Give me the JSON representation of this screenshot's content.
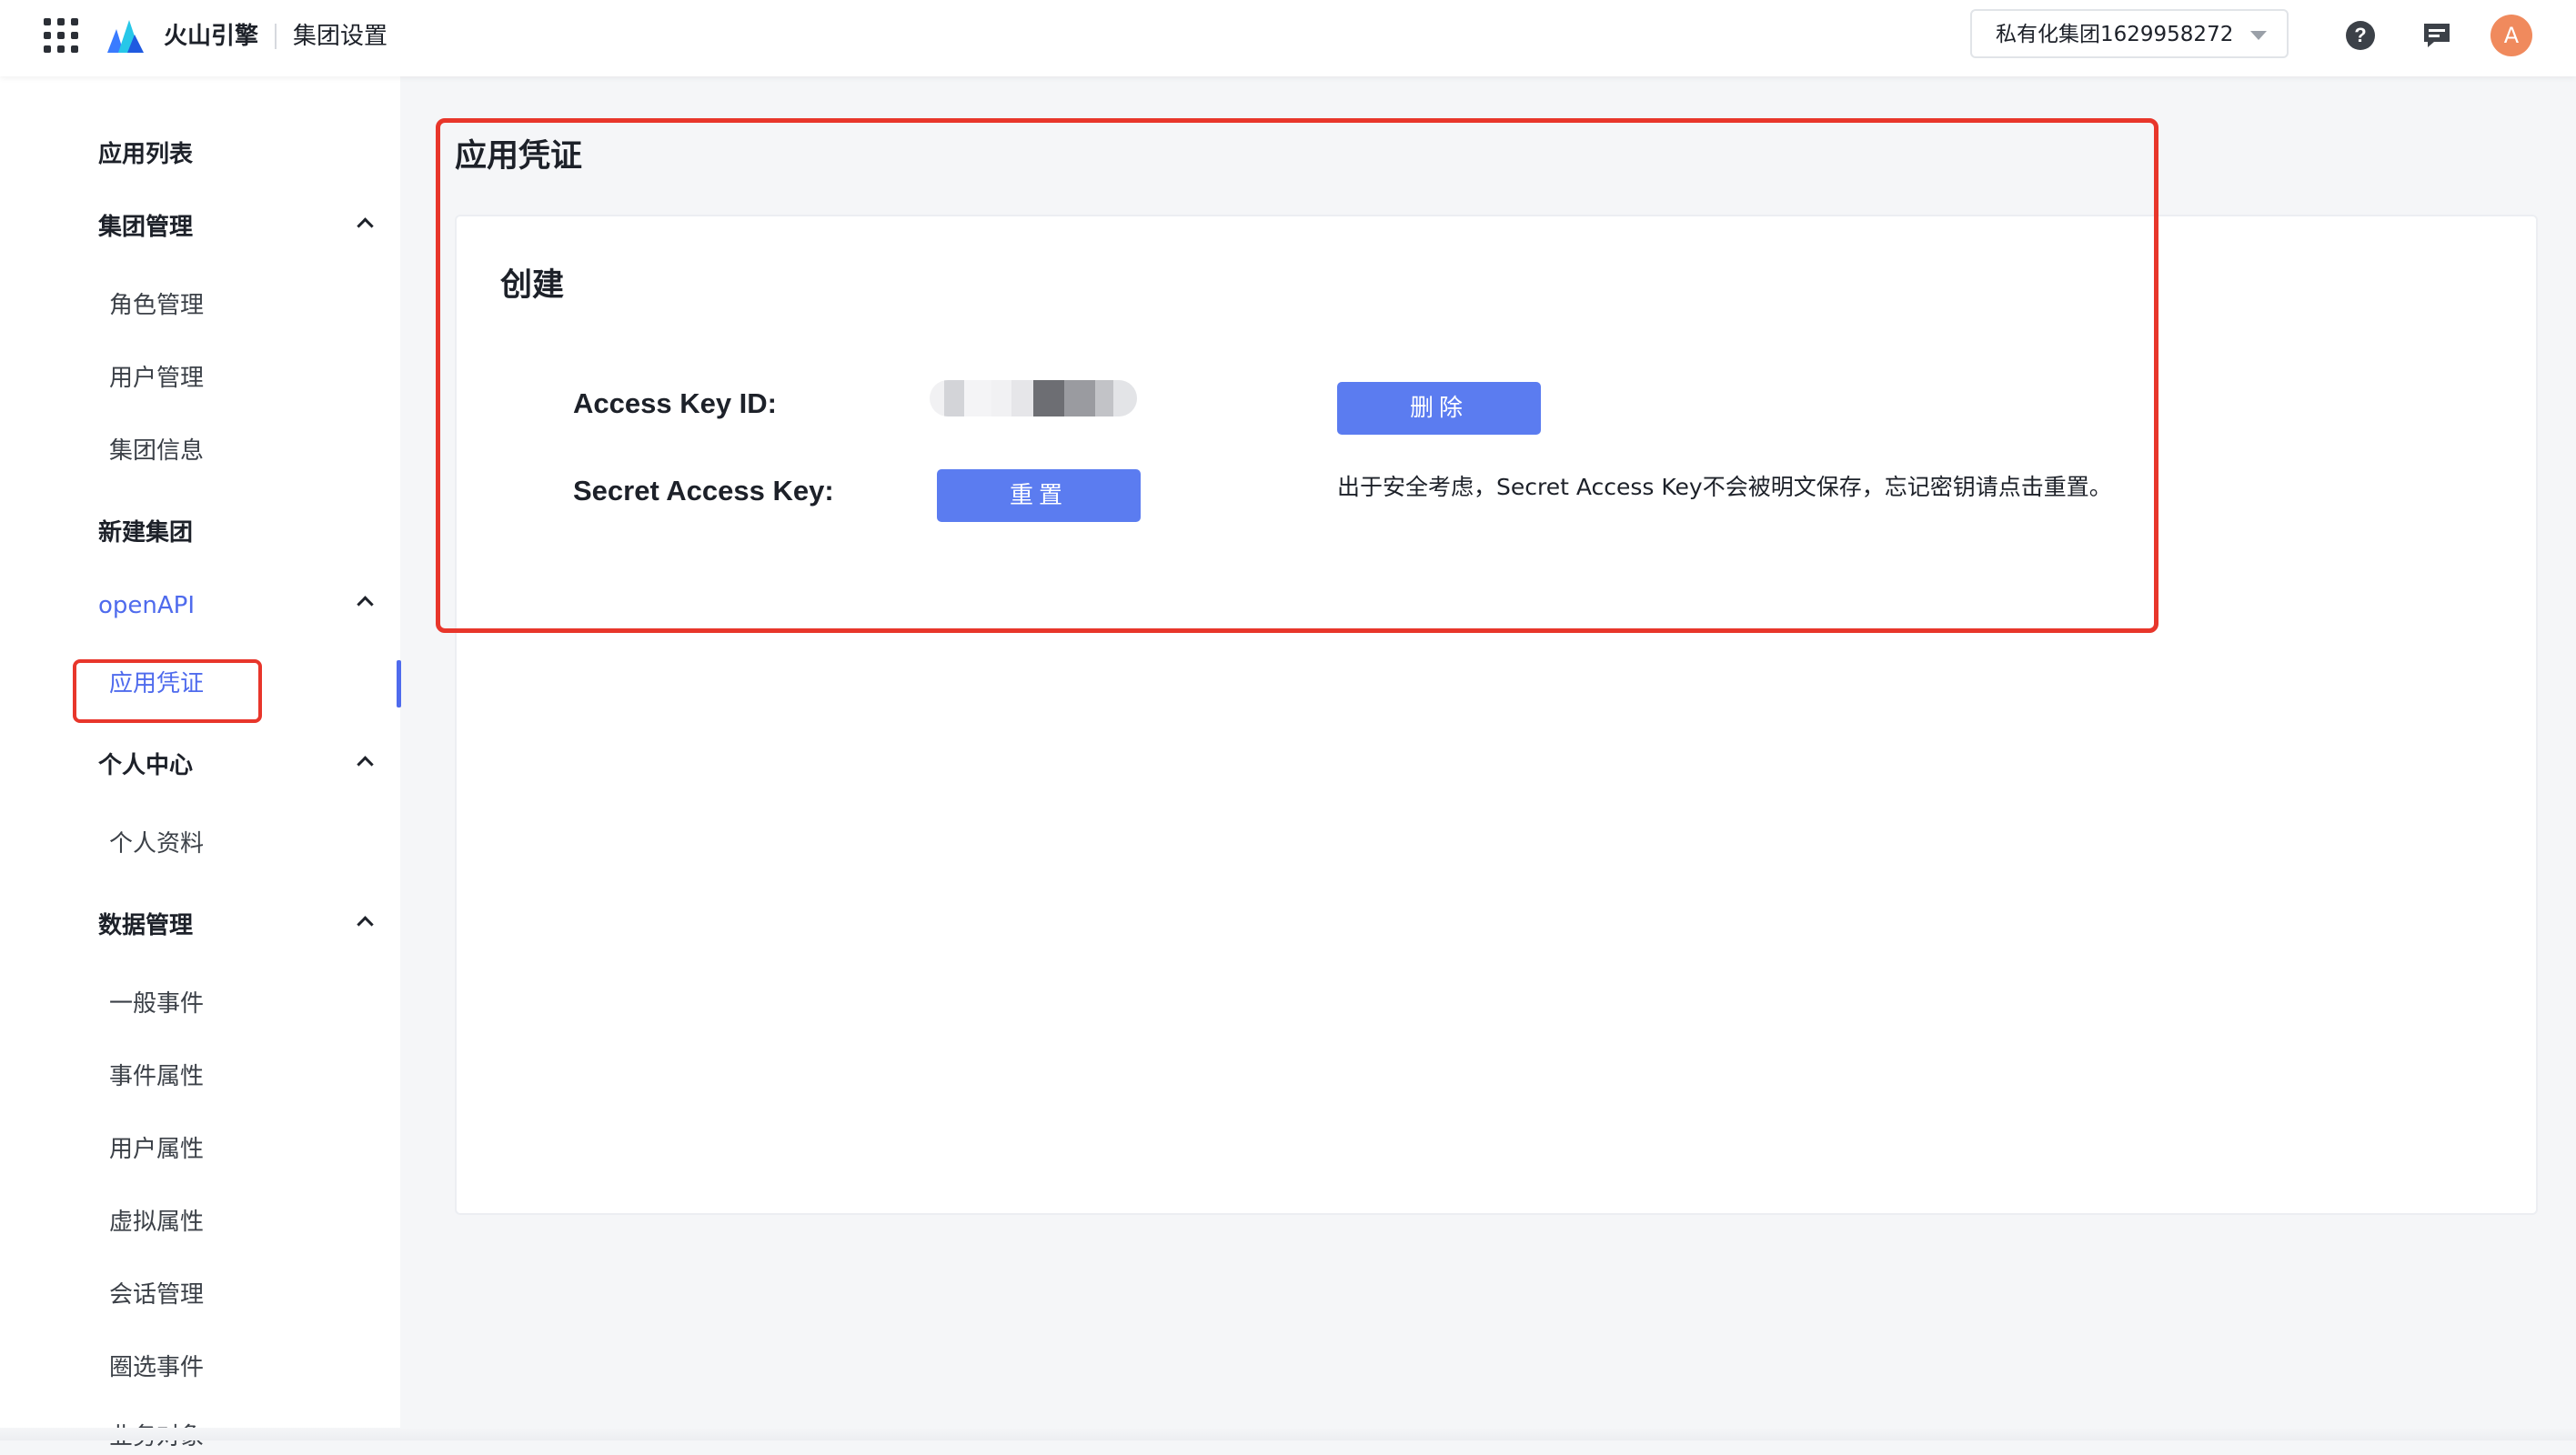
{
  "topbar": {
    "brand": "火山引擎",
    "section": "集团设置",
    "org_select": "私有化集团1629958272",
    "avatar_letter": "A"
  },
  "sidebar": {
    "items": [
      {
        "label": "应用列表"
      },
      {
        "label": "集团管理"
      },
      {
        "label": "角色管理"
      },
      {
        "label": "用户管理"
      },
      {
        "label": "集团信息"
      },
      {
        "label": "新建集团"
      },
      {
        "label": "openAPI"
      },
      {
        "label": "应用凭证"
      },
      {
        "label": "个人中心"
      },
      {
        "label": "个人资料"
      },
      {
        "label": "数据管理"
      },
      {
        "label": "一般事件"
      },
      {
        "label": "事件属性"
      },
      {
        "label": "用户属性"
      },
      {
        "label": "虚拟属性"
      },
      {
        "label": "会话管理"
      },
      {
        "label": "圈选事件"
      },
      {
        "label": "业务对象"
      }
    ]
  },
  "main": {
    "heading": "应用凭证",
    "card": {
      "title": "创建",
      "access_key_label": "Access Key ID:",
      "secret_key_label": "Secret Access Key:",
      "delete_label": "删除",
      "reset_label": "重置",
      "note": "出于安全考虑，Secret Access Key不会被明文保存，忘记密钥请点击重置。"
    }
  },
  "colors": {
    "accent": "#5b7cf0",
    "active_text": "#4f6bed",
    "highlight": "#e8362b",
    "avatar": "#f08a5d"
  }
}
